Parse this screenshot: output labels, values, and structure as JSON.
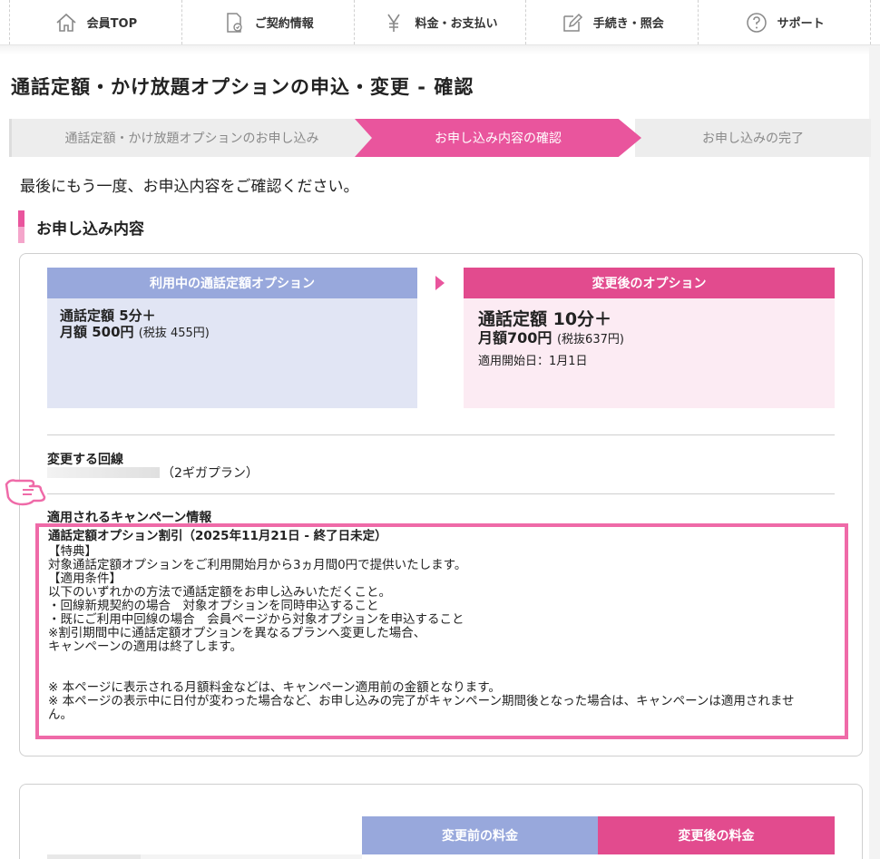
{
  "nav": {
    "items": [
      {
        "label": "会員TOP",
        "icon": "home-icon"
      },
      {
        "label": "ご契約情報",
        "icon": "contract-icon"
      },
      {
        "label": "料金・お支払い",
        "icon": "yen-icon"
      },
      {
        "label": "手続き・照会",
        "icon": "edit-icon"
      },
      {
        "label": "サポート",
        "icon": "question-icon"
      }
    ]
  },
  "page": {
    "title": "通話定額・かけ放題オプションの申込・変更 - 確認",
    "lead": "最後にもう一度、お申込内容をご確認ください。"
  },
  "steps": [
    {
      "label": "通話定額・かけ放題オプションのお申し込み",
      "state": "done"
    },
    {
      "label": "お申し込み内容の確認",
      "state": "current"
    },
    {
      "label": "お申し込みの完了",
      "state": "todo"
    }
  ],
  "section": {
    "title": "お申し込み内容"
  },
  "current_option": {
    "header": "利用中の通話定額オプション",
    "name": "通話定額 5分＋",
    "price": "月額 500円",
    "tax": "(税抜 455円)"
  },
  "new_option": {
    "header": "変更後のオプション",
    "name": "通話定額 10分＋",
    "price": "月額700円",
    "tax": "(税抜637円)",
    "start": "適用開始日：1月1日"
  },
  "line": {
    "label": "変更する回線",
    "plan": "（2ギガプラン）"
  },
  "campaign": {
    "label": "適用されるキャンペーン情報",
    "title": "通話定額オプション割引（2025年11月21日 - 終了日未定）",
    "lines": [
      "【特典】",
      "対象通話定額オプションをご利用開始月から3ヵ月間0円で提供いたします。",
      "【適用条件】",
      "以下のいずれかの方法で通話定額をお申し込みいただくこと。",
      "・回線新規契約の場合　対象オプションを同時申込すること",
      "・既にご利用中回線の場合　会員ページから対象オプションを申込すること",
      "※割引期間中に通話定額オプションを異なるプランへ変更した場合、",
      "キャンペーンの適用は終了します。"
    ],
    "notes": [
      "※ 本ページに表示される月額料金などは、キャンペーン適用前の金額となります。",
      "※ 本ページの表示中に日付が変わった場合など、お申し込みの完了がキャンペーン期間後となった場合は、キャンペーンは適用されませ",
      "ん。"
    ]
  },
  "fees": {
    "before": "変更前の料金",
    "after": "変更後の料金"
  },
  "colors": {
    "pink": "#e9559d",
    "blue": "#98a8dc",
    "pink_light": "#fcebf3",
    "blue_light": "#e1e5f4"
  }
}
